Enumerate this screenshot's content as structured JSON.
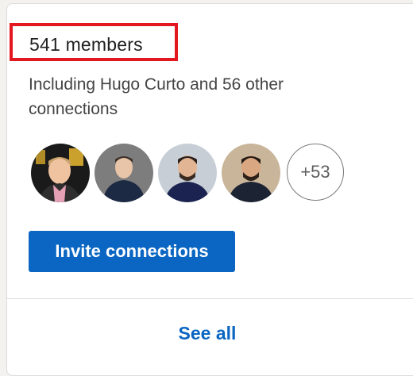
{
  "group": {
    "members_count": "541 members",
    "connections_text": "Including Hugo Curto and 56 other connections",
    "avatars": [
      {
        "name": "member-avatar-1"
      },
      {
        "name": "member-avatar-2"
      },
      {
        "name": "member-avatar-3"
      },
      {
        "name": "member-avatar-4"
      }
    ],
    "more_count": "+53",
    "invite_label": "Invite connections",
    "see_all_label": "See all"
  },
  "colors": {
    "accent": "#0a66c2",
    "highlight_box": "#e3171f"
  }
}
